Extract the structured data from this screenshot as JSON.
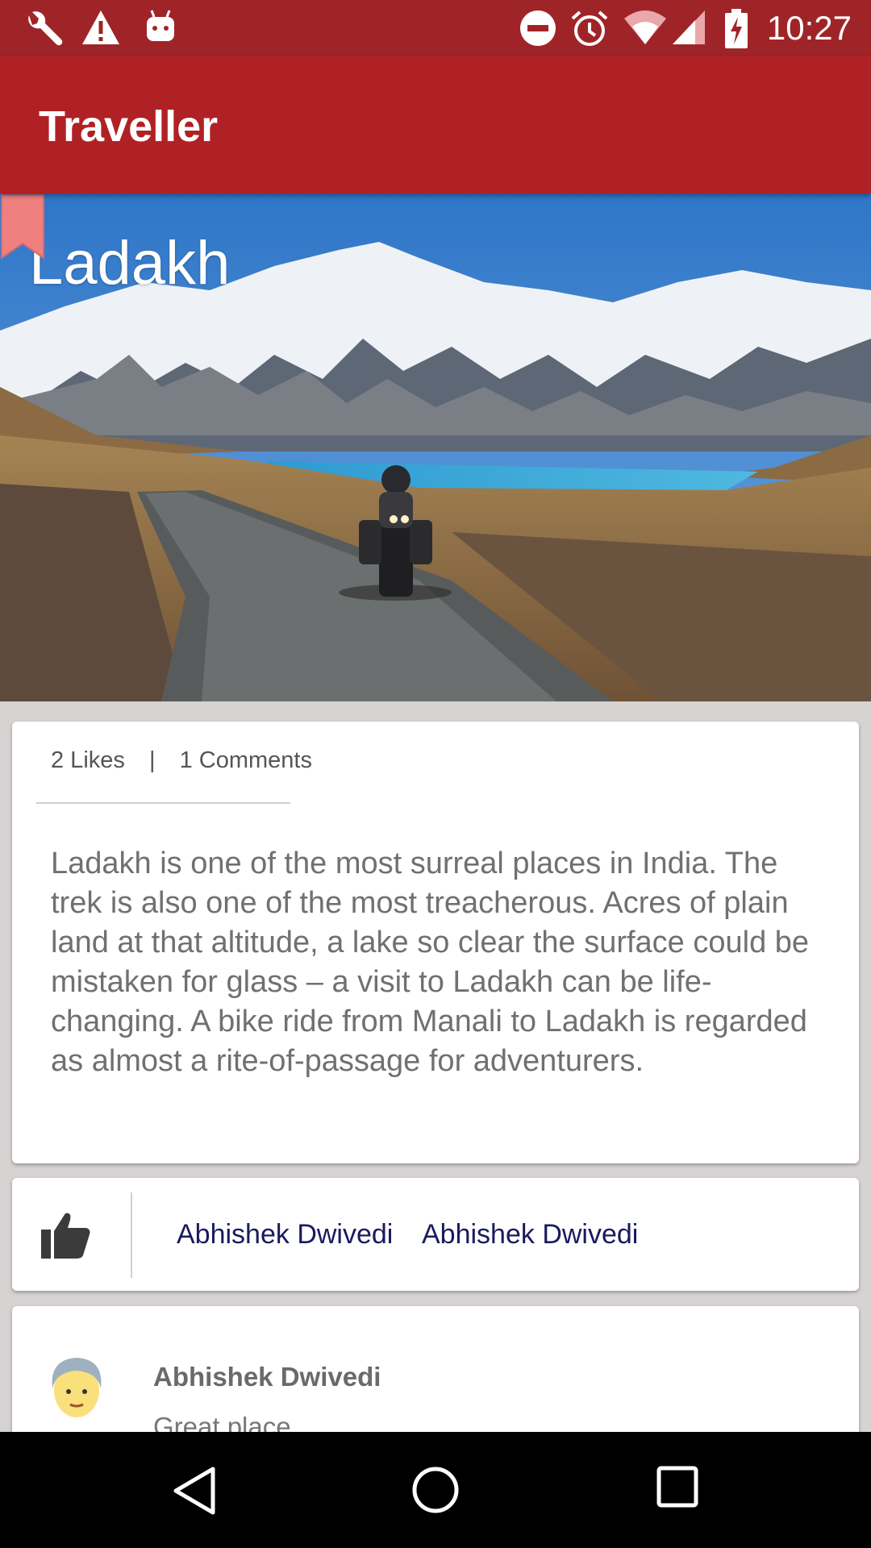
{
  "status_bar": {
    "time": "10:27",
    "left_icons": [
      "wrench-icon",
      "warning-icon",
      "android-debug-icon"
    ],
    "right_icons": [
      "do-not-disturb-icon",
      "alarm-icon",
      "wifi-icon",
      "signal-icon",
      "battery-charging-icon"
    ]
  },
  "app_bar": {
    "title": "Traveller"
  },
  "hero": {
    "title": "Ladakh",
    "bookmark_color": "#f08080"
  },
  "info": {
    "likes": "2 Likes",
    "separator": "|",
    "comments": "1 Comments",
    "description": "Ladakh is one of the most surreal places in India. The trek is also one of the most treacherous. Acres of plain land at that altitude, a lake so clear the surface could be mistaken for glass – a visit to Ladakh can be life-changing. A bike ride from Manali to Ladakh is regarded as almost a rite-of-passage for adventurers."
  },
  "likes_row": {
    "likers": [
      "Abhishek Dwivedi",
      "Abhishek Dwivedi"
    ]
  },
  "comment": {
    "author": "Abhishek Dwivedi",
    "text": "Great place"
  },
  "colors": {
    "status_bar": "#9f2428",
    "app_bar": "#b02125",
    "liker_text": "#1a1a5e"
  }
}
